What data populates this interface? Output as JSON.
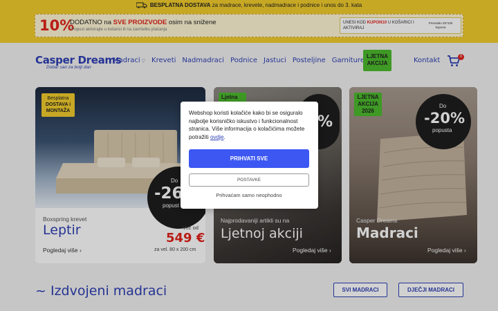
{
  "top_bar": {
    "shipping_bold": "BESPLATNA DOSTAVA",
    "shipping_rest": " za madrace, krevete, nadmadrace i podnice i unos do 3. kata"
  },
  "promo": {
    "percent": "10%",
    "line_pre": "DODATNO na ",
    "line_red": "SVE PROIZVODE",
    "line_post": " osim na snižene",
    "note": "*Popust aktivirajte u košarici ili na završetku plaćanja",
    "coupon_pre": "UNESI KOD ",
    "coupon_code": "KUPON10",
    "coupon_post": " U KOŠARICI I AKTIVIRAJ",
    "coupon_note_a": "Preostalo 25*100",
    "coupon_note_b": "kupona"
  },
  "header": {
    "logo": "Casper Dreams",
    "tagline": "Dobar san za bolji dan",
    "nav": [
      "Madraci",
      "Kreveti",
      "Nadmadraci",
      "Podnice",
      "Jastuci",
      "Posteljine",
      "Garniture"
    ],
    "badge_line1": "LJETNA",
    "badge_line2": "AKCIJA",
    "contact": "Kontakt",
    "cart_count": "0"
  },
  "cards": {
    "card1": {
      "badge_line1": "Besplatna",
      "badge_line2": "DOSTAVA i",
      "badge_line3": "MONTAŽA",
      "circle_do": "Do",
      "circle_pct": "-26",
      "circle_pop": "popust",
      "subtitle": "Boxspring krevet",
      "title": "Leptir",
      "from": "Već od",
      "price": "549 €",
      "size": "za vel. 80 x 200 cm",
      "link": "Pogledaj više"
    },
    "card2": {
      "badge": "Ljetna",
      "circle_pct": "%",
      "subtitle": "Najprodavaniji artikli su na",
      "title": "Ljetnoj akciji",
      "link": "Pogledaj više"
    },
    "card3": {
      "badge_line1": "LJETNA",
      "badge_line2": "AKCIJA",
      "badge_line3": "2026",
      "circle_do": "Do",
      "circle_pct": "-20%",
      "circle_pop": "popusta",
      "subtitle": "Casper Dreams",
      "title": "Madraci",
      "link": "Pogledaj više"
    }
  },
  "cookie": {
    "text": "Webshop koristi kolačiće kako bi se osiguralo najbolje korisničko iskustvo i funkcionalnost stranica. Više informacija o kolačićima možete potražiti ",
    "link": "ovdje",
    "accept": "PRIHVATI SVE",
    "settings": "POSTAVKE",
    "necessary": "Prihvaćam samo neophodno"
  },
  "featured": {
    "title": "~ Izdvojeni madraci",
    "btn_all": "SVI MADRACI",
    "btn_kids": "DJEČJI MADRACI"
  },
  "colors": {
    "brand_blue": "#2d3fb4",
    "accent_yellow": "#f3ce2e",
    "accent_green": "#4cbb2e",
    "sale_red": "#e2231a",
    "button_blue": "#3d57f2"
  }
}
